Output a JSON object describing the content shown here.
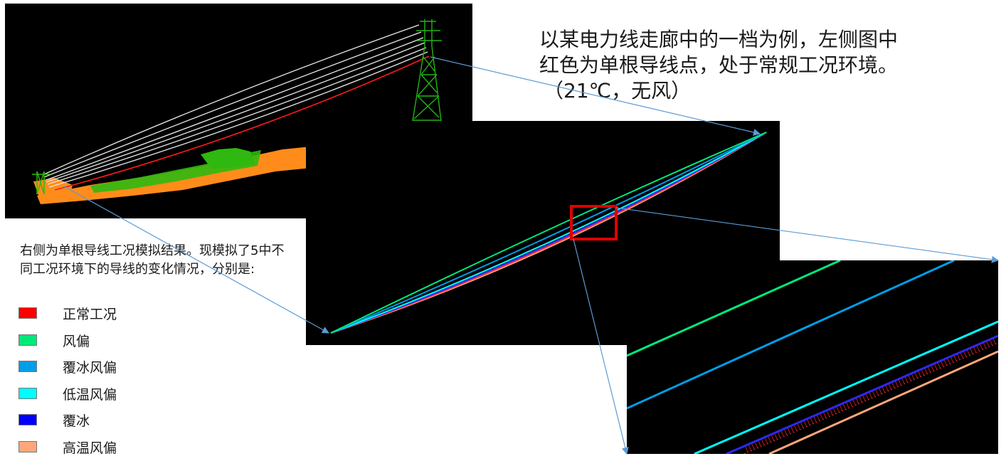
{
  "intro": {
    "line1": "以某电力线走廊中的一档为例，左侧图中",
    "line2": "红色为单根导线点，处于常规工况环境。",
    "line3": "（21℃，无风）"
  },
  "description": "右侧为单根导线工况模拟结果。现模拟了5中不同工况环境下的导线的变化情况，分别是:",
  "legend": [
    {
      "label": "正常工况",
      "color": "#ff0000"
    },
    {
      "label": "风偏",
      "color": "#00e87a"
    },
    {
      "label": "覆冰风偏",
      "color": "#009ee8"
    },
    {
      "label": "低温风偏",
      "color": "#00ffff"
    },
    {
      "label": "覆冰",
      "color": "#0000ff"
    },
    {
      "label": "高温风偏",
      "color": "#ffa77a"
    }
  ],
  "colors": {
    "panel_background": "#000000",
    "tower": "#22b514",
    "ground_orange": "#ff8c1a",
    "ground_green": "#2fb80f",
    "conductor_white": "#e8e8e8",
    "arrow": "#5b9bd5",
    "highlight_box": "#e00000"
  }
}
